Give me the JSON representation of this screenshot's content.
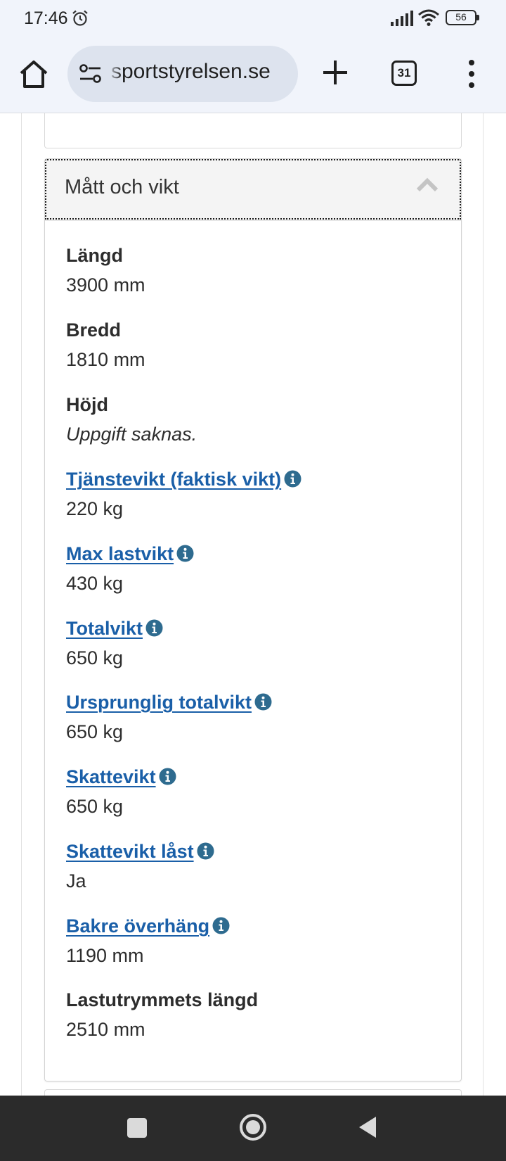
{
  "status_bar": {
    "time": "17:46",
    "battery": "56",
    "icons": [
      "alarm-icon",
      "signal-icon",
      "wifi-icon",
      "battery-icon"
    ]
  },
  "browser": {
    "url": "sportstyrelsen.se",
    "tab_count": "31",
    "icons": [
      "home-icon",
      "site-settings-icon",
      "plus-icon",
      "tabs-icon",
      "more-vert-icon"
    ]
  },
  "panel": {
    "title": "Mått och vikt",
    "expanded": true,
    "fields": [
      {
        "label": "Längd",
        "value": "3900 mm",
        "link": false,
        "info": false
      },
      {
        "label": "Bredd",
        "value": "1810 mm",
        "link": false,
        "info": false
      },
      {
        "label": "Höjd",
        "value": "Uppgift saknas.",
        "link": false,
        "info": false,
        "missing": true
      },
      {
        "label": "Tjänstevikt (faktisk vikt)",
        "value": "220 kg",
        "link": true,
        "info": true
      },
      {
        "label": "Max lastvikt",
        "value": "430 kg",
        "link": true,
        "info": true
      },
      {
        "label": "Totalvikt",
        "value": "650 kg",
        "link": true,
        "info": true
      },
      {
        "label": "Ursprunglig totalvikt",
        "value": "650 kg",
        "link": true,
        "info": true
      },
      {
        "label": "Skattevikt",
        "value": "650 kg",
        "link": true,
        "info": true
      },
      {
        "label": "Skattevikt låst",
        "value": "Ja",
        "link": true,
        "info": true
      },
      {
        "label": "Bakre överhäng",
        "value": "1190 mm",
        "link": true,
        "info": true
      },
      {
        "label": "Lastutrymmets längd",
        "value": "2510 mm",
        "link": false,
        "info": false
      }
    ]
  },
  "colors": {
    "link": "#1a5fa8",
    "info_icon": "#2e6b8f",
    "chrome_bg": "#f1f4fb",
    "nav_bar": "#2b2b2b"
  }
}
